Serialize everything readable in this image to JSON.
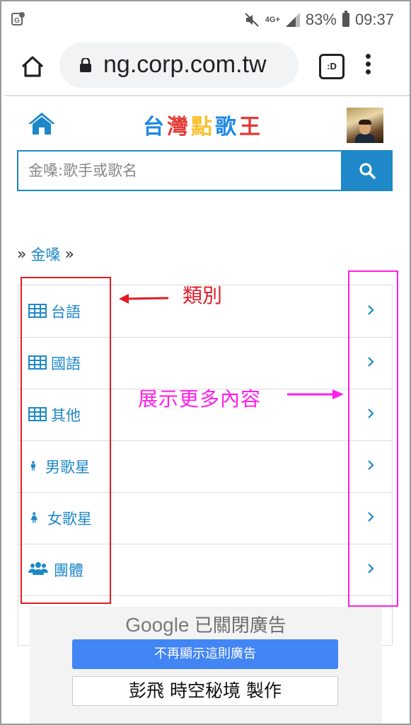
{
  "status_bar": {
    "network": "4G+",
    "battery": "83%",
    "time": "09:37"
  },
  "browser": {
    "url": "ng.corp.com.tw",
    "tab_label": ":D"
  },
  "site": {
    "title_chars": [
      {
        "char": "台",
        "color": "#1e88e5"
      },
      {
        "char": "灣",
        "color": "#e53935"
      },
      {
        "char": "點",
        "color": "#fbc02d"
      },
      {
        "char": "歌",
        "color": "#1e88e5"
      },
      {
        "char": "王",
        "color": "#e53935"
      }
    ],
    "accent_color": "#1e88c8"
  },
  "search": {
    "placeholder": "金嗓:歌手或歌名"
  },
  "breadcrumb": {
    "sep": "»",
    "item": "金嗓"
  },
  "categories": [
    {
      "label": "台語",
      "icon": "table-icon"
    },
    {
      "label": "國語",
      "icon": "table-icon"
    },
    {
      "label": "其他",
      "icon": "table-icon"
    },
    {
      "label": "男歌星",
      "icon": "male-icon"
    },
    {
      "label": "女歌星",
      "icon": "female-icon"
    },
    {
      "label": "團體",
      "icon": "group-icon"
    }
  ],
  "annotations": {
    "category_note": "類別",
    "more_note": "展示更多內容"
  },
  "ad": {
    "brand": "Google",
    "closed_text": "已關閉廣告",
    "stop_button": "不再顯示這則廣告",
    "credit": "彭飛 時空秘境 製作"
  }
}
